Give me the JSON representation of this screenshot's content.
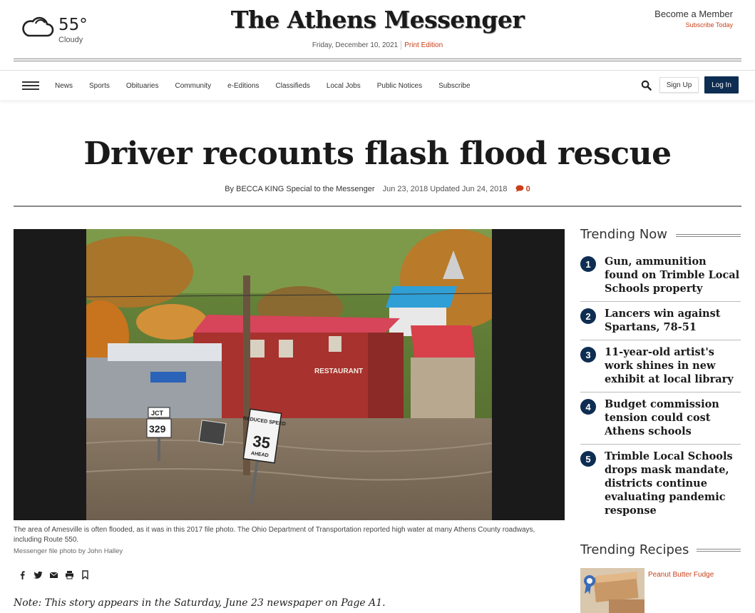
{
  "weather": {
    "temp": "55°",
    "condition": "Cloudy",
    "icon": "cloud-icon"
  },
  "masthead": {
    "title": "The Athens Messenger",
    "date": "Friday, December 10, 2021",
    "print_edition": "Print Edition"
  },
  "membership": {
    "become": "Become a Member",
    "subscribe": "Subscribe Today"
  },
  "nav": {
    "items": [
      "News",
      "Sports",
      "Obituaries",
      "Community",
      "e-Editions",
      "Classifieds",
      "Local Jobs",
      "Public Notices",
      "Subscribe"
    ],
    "signup": "Sign Up",
    "login": "Log In"
  },
  "article": {
    "headline": "Driver recounts flash flood rescue",
    "byline": "By BECCA KING Special to the Messenger",
    "dates": "Jun 23, 2018 Updated Jun 24, 2018",
    "comment_count": "0",
    "caption": "The area of Amesville is often flooded, as it was in this 2017 file photo. The Ohio Department of Transportation reported high water at many Athens County roadways, including Route 550.",
    "credit": "Messenger file photo by John Halley",
    "note": "Note: This story appears in the Saturday, June 23 newspaper on Page A1.",
    "photo_signs": {
      "restaurant": "RESTAURANT",
      "jct": "JCT",
      "route": "329",
      "speed_top": "REDUCED SPEED",
      "speed_val": "35",
      "speed_bottom": "AHEAD"
    }
  },
  "trending": {
    "title": "Trending Now",
    "items": [
      {
        "num": "1",
        "text": "Gun, ammunition found on Trimble Local Schools property"
      },
      {
        "num": "2",
        "text": "Lancers win against Spartans, 78-51"
      },
      {
        "num": "3",
        "text": "11-year-old artist's work shines in new exhibit at local library"
      },
      {
        "num": "4",
        "text": "Budget commission tension could cost Athens schools"
      },
      {
        "num": "5",
        "text": "Trimble Local Schools drops mask mandate, districts continue evaluating pandemic response"
      }
    ]
  },
  "recipes": {
    "title": "Trending Recipes",
    "items": [
      {
        "text": "Peanut Butter Fudge"
      }
    ]
  },
  "colors": {
    "brand_navy": "#0e2d52",
    "accent_orange": "#c8411b"
  }
}
